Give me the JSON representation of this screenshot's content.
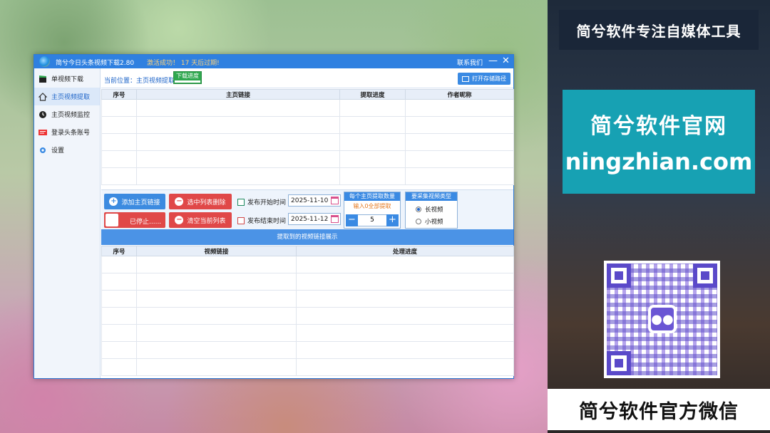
{
  "app": {
    "title": "简兮今日头条视频下载2.80",
    "status": "激活成功！  17 天后过期!",
    "contact": "联系我们",
    "minimize": "—",
    "close": "✕"
  },
  "sidebar": {
    "items": [
      {
        "label": "单视频下载",
        "icon": "clapperboard-icon"
      },
      {
        "label": "主页视频提取",
        "icon": "home-icon"
      },
      {
        "label": "主页视频监控",
        "icon": "monitor-icon"
      },
      {
        "label": "登录头条账号",
        "icon": "toutiao-logo-icon"
      },
      {
        "label": "设置",
        "icon": "gear-icon"
      }
    ]
  },
  "main": {
    "breadcrumb": "当前位置：主页视频提取",
    "progress_tab": "下载进度",
    "open_folder": "打开存储路径",
    "top_table": {
      "columns": [
        "序号",
        "主页链接",
        "提取进度",
        "作者昵称"
      ]
    },
    "toolbar": {
      "add_link": "添加主页链接",
      "delete_selected": "选中列表删除",
      "stopped": "已停止......",
      "clear_list": "清空当前列表",
      "start_time_label": "发布开始时间",
      "start_date": "2025-11-10",
      "end_time_label": "发布结束时间",
      "end_date": "2025-11-12",
      "per_page_title": "每个主页提取数量",
      "per_page_hint": "输入0全部提取",
      "per_page_value": "5",
      "minus": "−",
      "plus": "+",
      "type_title": "要采集视频类型",
      "type_long": "长视频",
      "type_short": "小视频"
    },
    "result_bar": "提取到的视频链接展示",
    "bottom_table": {
      "columns": [
        "序号",
        "视频链接",
        "处理进度"
      ]
    }
  },
  "promo": {
    "top_banner": "简兮软件专注自媒体工具",
    "site_cn": "简兮软件官网",
    "site_url": "ningzhian.com",
    "bottom_banner": "简兮软件官方微信",
    "qr_icon": "wechat-icon"
  }
}
